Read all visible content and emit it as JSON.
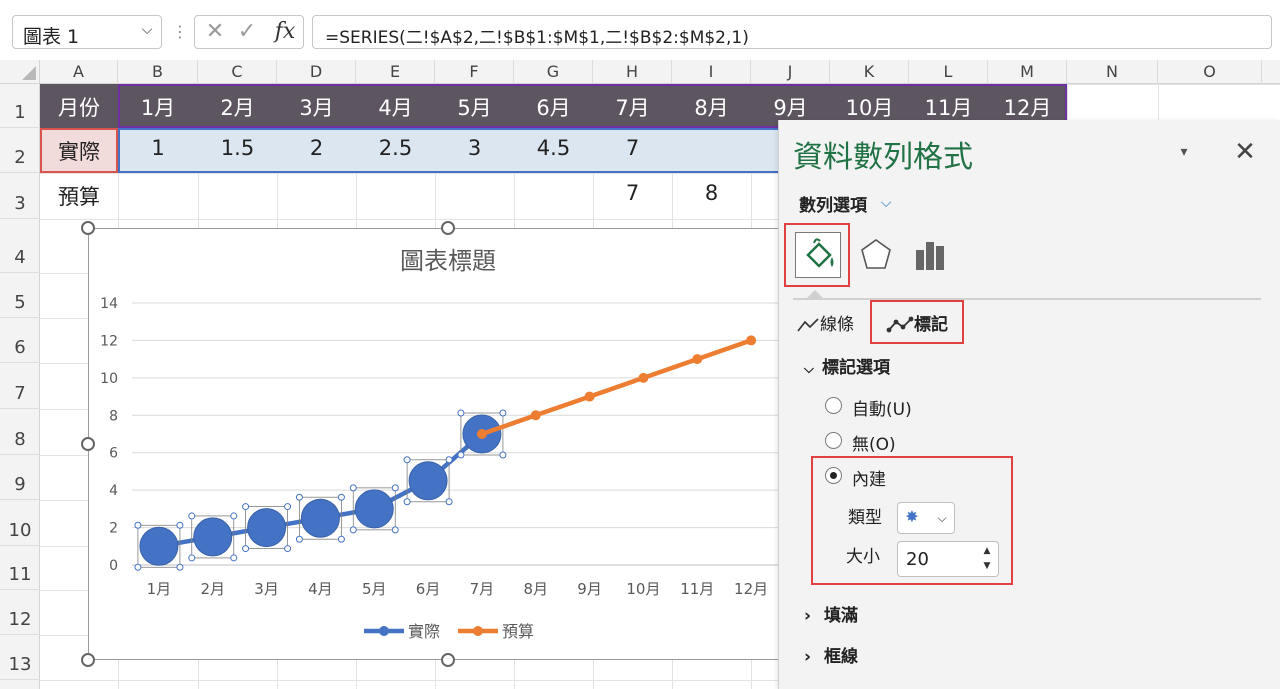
{
  "formula_bar": {
    "name_box": "圖表 1",
    "name_box_arrow": "⌵",
    "dots": "⋮",
    "cancel_glyph": "✕",
    "enter_glyph": "✓",
    "fx_label": "fx",
    "formula": "=SERIES(二!$A$2,二!$B$1:$M$1,二!$B$2:$M$2,1)"
  },
  "grid": {
    "columns": [
      "A",
      "B",
      "C",
      "D",
      "E",
      "F",
      "G",
      "H",
      "I",
      "J",
      "K",
      "L",
      "M",
      "N",
      "O"
    ],
    "rows": [
      "1",
      "2",
      "3",
      "4",
      "5",
      "6",
      "7",
      "8",
      "9",
      "10",
      "11",
      "12",
      "13"
    ],
    "row1": [
      "月份",
      "1月",
      "2月",
      "3月",
      "4月",
      "5月",
      "6月",
      "7月",
      "8月",
      "9月",
      "10月",
      "11月",
      "12月"
    ],
    "row2": [
      "實際",
      "1",
      "1.5",
      "2",
      "2.5",
      "3",
      "4.5",
      "7"
    ],
    "row3": [
      "預算",
      "",
      "",
      "",
      "",
      "",
      "",
      "7",
      "8"
    ]
  },
  "chart_data": {
    "type": "line",
    "title": "圖表標題",
    "categories": [
      "1月",
      "2月",
      "3月",
      "4月",
      "5月",
      "6月",
      "7月",
      "8月",
      "9月",
      "10月",
      "11月",
      "12月"
    ],
    "series": [
      {
        "name": "實際",
        "values": [
          1,
          1.5,
          2,
          2.5,
          3,
          4.5,
          7,
          null,
          null,
          null,
          null,
          null
        ],
        "color": "#4472c4"
      },
      {
        "name": "預算",
        "values": [
          null,
          null,
          null,
          null,
          null,
          null,
          7,
          8,
          9,
          10,
          11,
          12
        ],
        "color": "#ed7d31"
      }
    ],
    "ylim": [
      0,
      14
    ],
    "yticks": [
      0,
      2,
      4,
      6,
      8,
      10,
      12,
      14
    ],
    "grid": true,
    "legend_position": "bottom"
  },
  "pane": {
    "title": "資料數列格式",
    "dropdown_glyph": "▾",
    "close_glyph": "✕",
    "series_options": "數列選項",
    "series_options_chevron": "⌵",
    "tab_line": "線條",
    "tab_marker": "標記",
    "marker_options": "標記選項",
    "radio_auto": "自動(U)",
    "radio_none": "無(O)",
    "radio_builtin": "內建",
    "type_label": "類型",
    "type_glyph": "✸",
    "type_chevron": "⌵",
    "size_label": "大小",
    "size_value": "20",
    "fill_section": "填滿",
    "border_section": "框線"
  }
}
